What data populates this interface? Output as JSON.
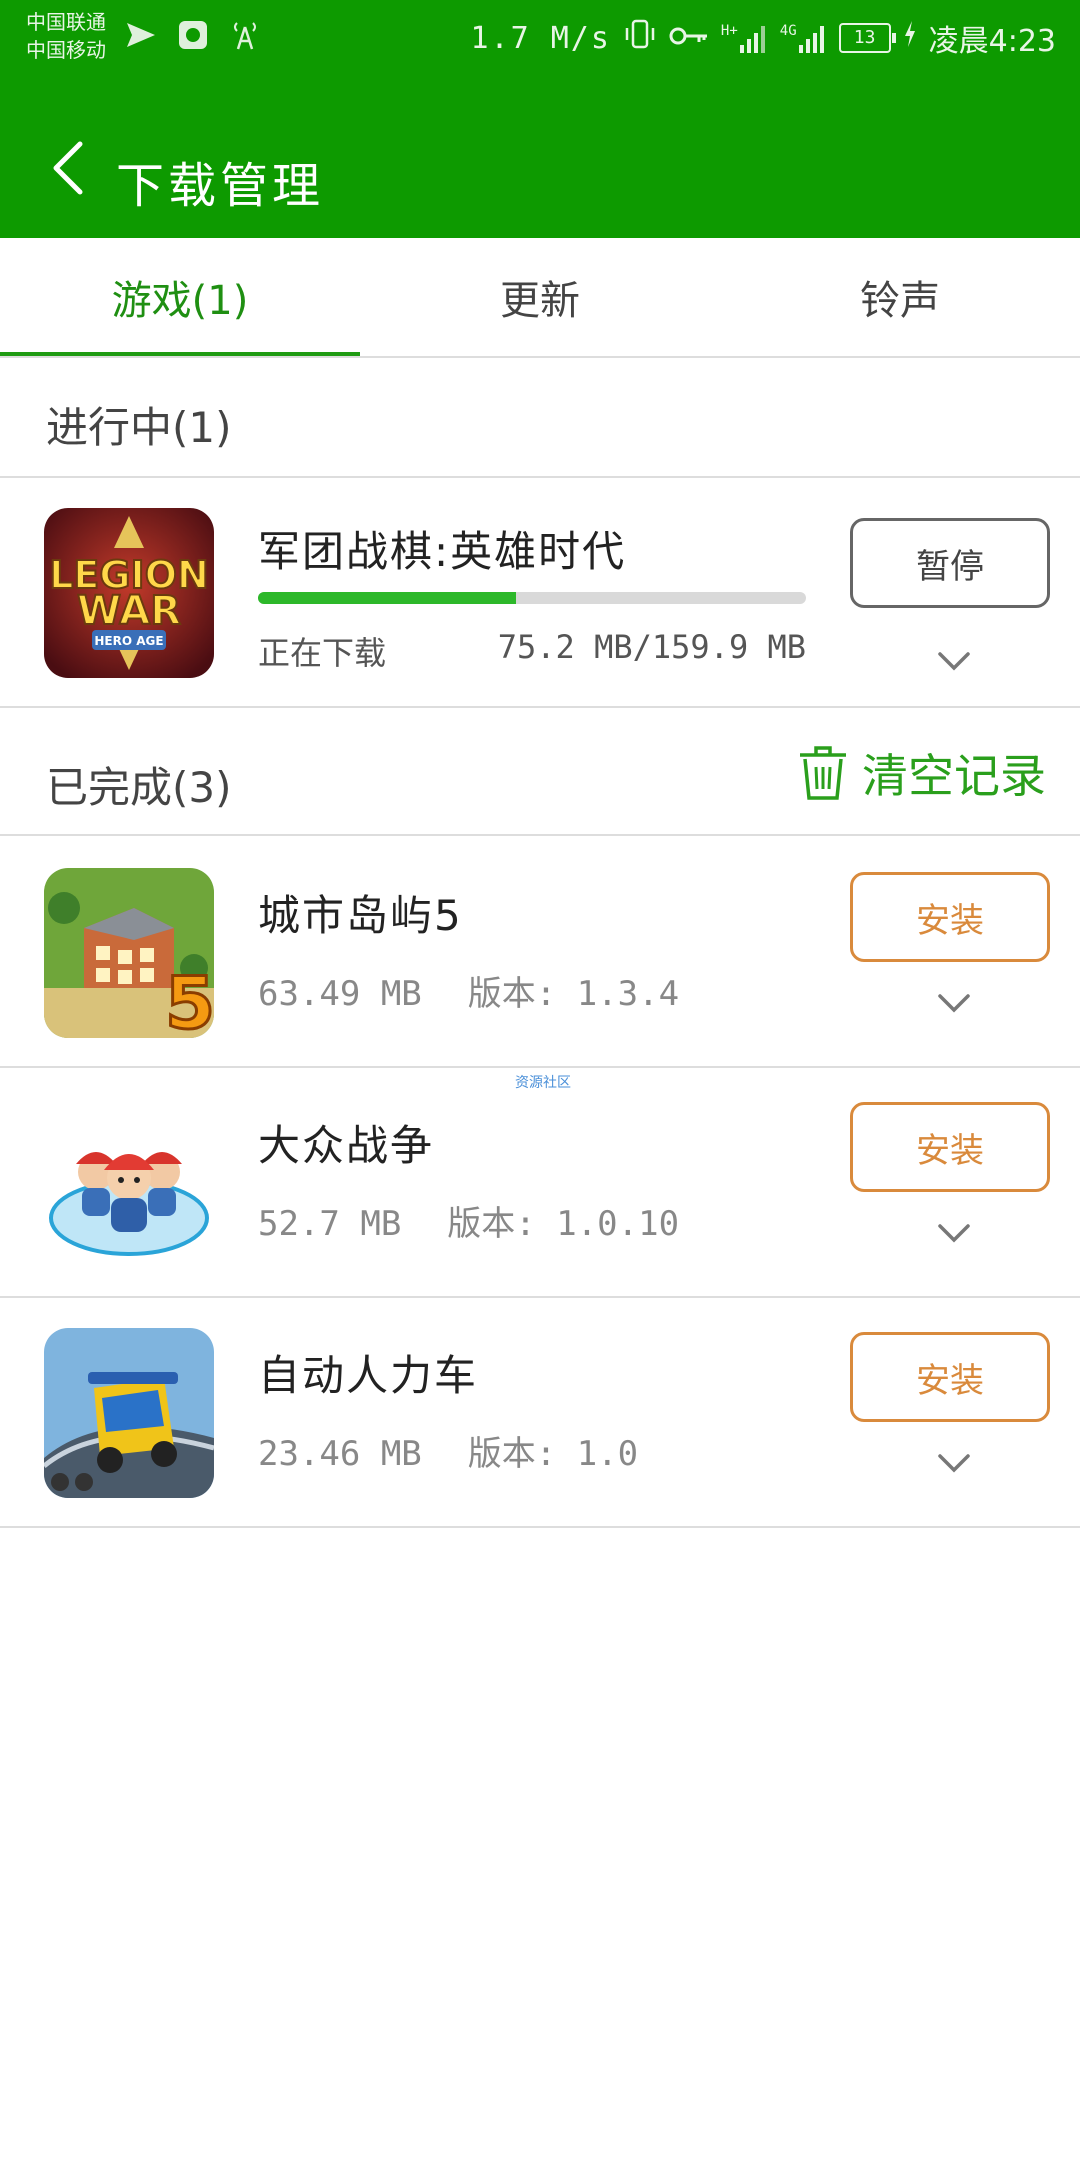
{
  "status_bar": {
    "carrier_1": "中国联通",
    "carrier_2": "中国移动",
    "speed": "1.7 M/s",
    "network_1": "H+",
    "network_2": "4G",
    "battery": "13",
    "time": "凌晨4:23"
  },
  "header": {
    "title": "下载管理"
  },
  "tabs": [
    {
      "label": "游戏(1)",
      "active": true
    },
    {
      "label": "更新",
      "active": false
    },
    {
      "label": "铃声",
      "active": false
    }
  ],
  "in_progress": {
    "title": "进行中(1)",
    "item": {
      "name": "军团战棋:英雄时代",
      "status": "正在下载",
      "size": "75.2 MB/159.9 MB",
      "progress": 0.47,
      "action": "暂停",
      "icon": "legion-war-icon"
    }
  },
  "completed": {
    "title": "已完成(3)",
    "clear_label": "清空记录",
    "items": [
      {
        "name": "城市岛屿5",
        "size": "63.49 MB",
        "version": "版本: 1.3.4",
        "action": "安装",
        "icon": "city-island-icon"
      },
      {
        "name": "大众战争",
        "size": "52.7 MB",
        "version": "版本: 1.0.10",
        "action": "安装",
        "icon": "people-war-icon"
      },
      {
        "name": "自动人力车",
        "size": "23.46 MB",
        "version": "版本: 1.0",
        "action": "安装",
        "icon": "tuktuk-icon"
      }
    ]
  },
  "watermark": "资源社区",
  "colors": {
    "header_green": "#0d9a00",
    "accent_green": "#2a9f1c",
    "install_orange": "#d98a3c"
  }
}
